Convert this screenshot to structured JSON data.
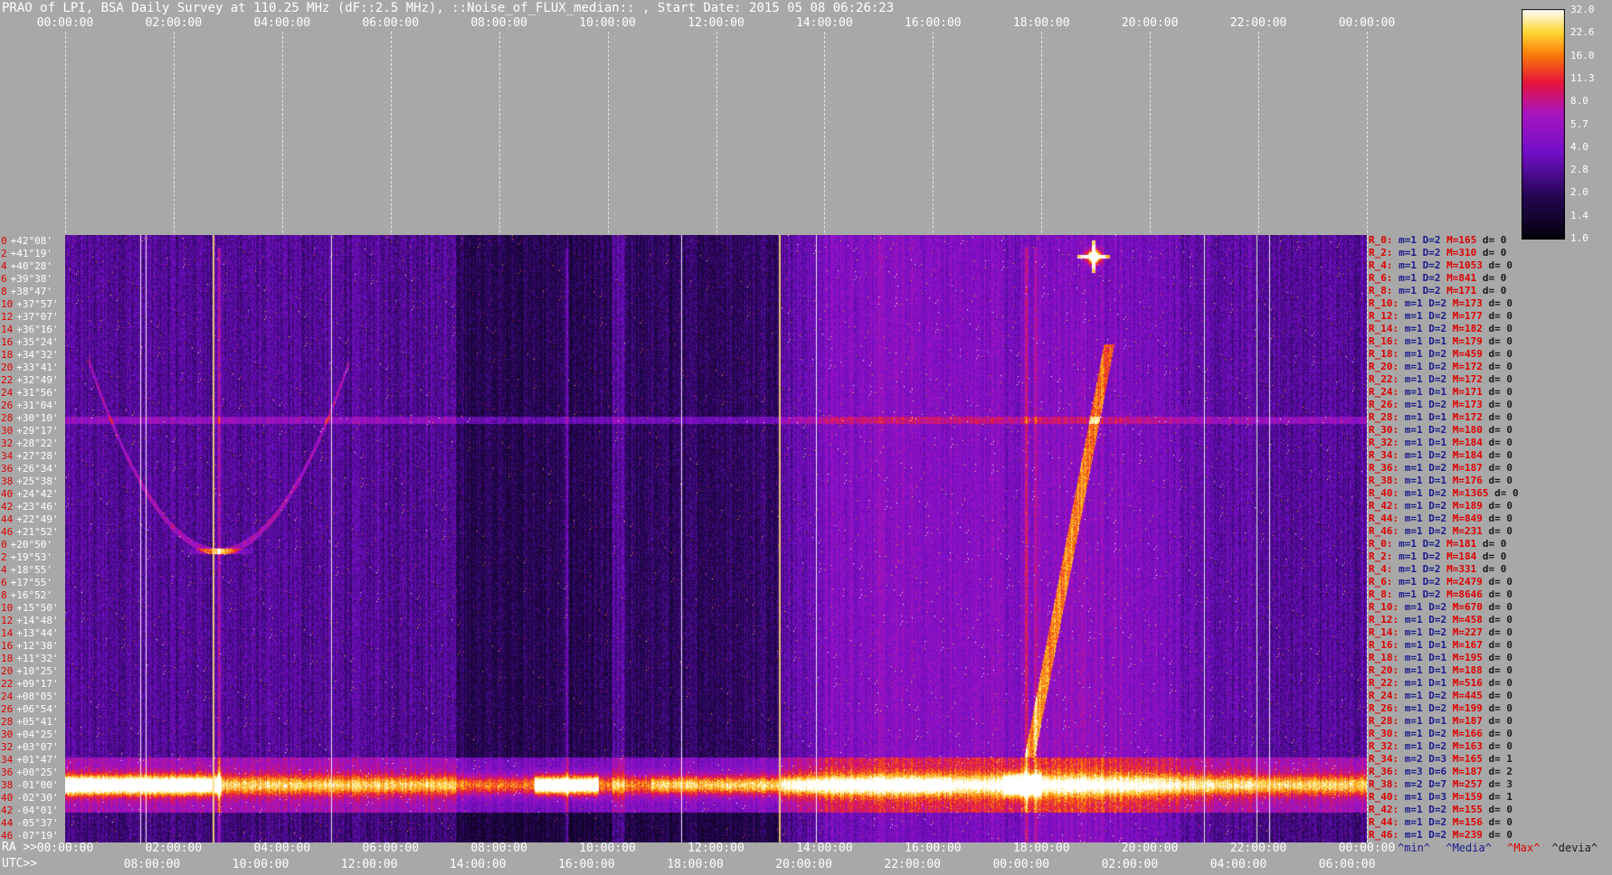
{
  "title": "PRAO of LPI, BSA Daily Survey at 110.25 MHz (dF::2.5 MHz), ::Noise_of_FLUX_median:: , Start Date: 2015 05 08 06:26:23",
  "top_ticks": [
    "00:00:00",
    "02:00:00",
    "04:00:00",
    "06:00:00",
    "08:00:00",
    "10:00:00",
    "12:00:00",
    "14:00:00",
    "16:00:00",
    "18:00:00",
    "20:00:00",
    "22:00:00",
    "00:00:00"
  ],
  "ra_label": "RA >>",
  "utc_label": "UTC>>",
  "ra_ticks": [
    "00:00:00",
    "02:00:00",
    "04:00:00",
    "06:00:00",
    "08:00:00",
    "10:00:00",
    "12:00:00",
    "14:00:00",
    "16:00:00",
    "18:00:00",
    "20:00:00",
    "22:00:00",
    "00:00:00"
  ],
  "utc_ticks": [
    "08:00:00",
    "10:00:00",
    "12:00:00",
    "14:00:00",
    "16:00:00",
    "18:00:00",
    "20:00:00",
    "22:00:00",
    "00:00:00",
    "02:00:00",
    "04:00:00",
    "06:00:00"
  ],
  "declinations": [
    {
      "n": "0",
      "v": "+42°08'"
    },
    {
      "n": "2",
      "v": "+41°19'"
    },
    {
      "n": "4",
      "v": "+40°28'"
    },
    {
      "n": "6",
      "v": "+39°38'"
    },
    {
      "n": "8",
      "v": "+38°47'"
    },
    {
      "n": "10",
      "v": "+37°57'"
    },
    {
      "n": "12",
      "v": "+37°07'"
    },
    {
      "n": "14",
      "v": "+36°16'"
    },
    {
      "n": "16",
      "v": "+35°24'"
    },
    {
      "n": "18",
      "v": "+34°32'"
    },
    {
      "n": "20",
      "v": "+33°41'"
    },
    {
      "n": "22",
      "v": "+32°49'"
    },
    {
      "n": "24",
      "v": "+31°56'"
    },
    {
      "n": "26",
      "v": "+31°04'"
    },
    {
      "n": "28",
      "v": "+30°10'"
    },
    {
      "n": "30",
      "v": "+29°17'"
    },
    {
      "n": "32",
      "v": "+28°22'"
    },
    {
      "n": "34",
      "v": "+27°28'"
    },
    {
      "n": "36",
      "v": "+26°34'"
    },
    {
      "n": "38",
      "v": "+25°38'"
    },
    {
      "n": "40",
      "v": "+24°42'"
    },
    {
      "n": "42",
      "v": "+23°46'"
    },
    {
      "n": "44",
      "v": "+22°49'"
    },
    {
      "n": "46",
      "v": "+21°52'"
    },
    {
      "n": "0",
      "v": "+20°50'"
    },
    {
      "n": "2",
      "v": "+19°53'"
    },
    {
      "n": "4",
      "v": "+18°55'"
    },
    {
      "n": "6",
      "v": "+17°55'"
    },
    {
      "n": "8",
      "v": "+16°52'"
    },
    {
      "n": "10",
      "v": "+15°50'"
    },
    {
      "n": "12",
      "v": "+14°48'"
    },
    {
      "n": "14",
      "v": "+13°44'"
    },
    {
      "n": "16",
      "v": "+12°38'"
    },
    {
      "n": "18",
      "v": "+11°32'"
    },
    {
      "n": "20",
      "v": "+10°25'"
    },
    {
      "n": "22",
      "v": "+09°17'"
    },
    {
      "n": "24",
      "v": "+08°05'"
    },
    {
      "n": "26",
      "v": "+06°54'"
    },
    {
      "n": "28",
      "v": "+05°41'"
    },
    {
      "n": "30",
      "v": "+04°25'"
    },
    {
      "n": "32",
      "v": "+03°07'"
    },
    {
      "n": "34",
      "v": "+01°47'"
    },
    {
      "n": "36",
      "v": "+00°25'"
    },
    {
      "n": "38",
      "v": "-01°00'"
    },
    {
      "n": "40",
      "v": "-02°30'"
    },
    {
      "n": "42",
      "v": "-04°01'"
    },
    {
      "n": "44",
      "v": "-05°37'"
    },
    {
      "n": "46",
      "v": "-07°19'"
    }
  ],
  "stats": [
    {
      "r": "R_0:",
      "m": "m=1",
      "d": "D=2",
      "x": "M=165",
      "dv": "d= 0"
    },
    {
      "r": "R_2:",
      "m": "m=1",
      "d": "D=2",
      "x": "M=310",
      "dv": "d= 0"
    },
    {
      "r": "R_4:",
      "m": "m=1",
      "d": "D=2",
      "x": "M=1053",
      "dv": "d= 0"
    },
    {
      "r": "R_6:",
      "m": "m=1",
      "d": "D=2",
      "x": "M=841",
      "dv": "d= 0"
    },
    {
      "r": "R_8:",
      "m": "m=1",
      "d": "D=2",
      "x": "M=171",
      "dv": "d= 0"
    },
    {
      "r": "R_10:",
      "m": "m=1",
      "d": "D=2",
      "x": "M=173",
      "dv": "d= 0"
    },
    {
      "r": "R_12:",
      "m": "m=1",
      "d": "D=2",
      "x": "M=177",
      "dv": "d= 0"
    },
    {
      "r": "R_14:",
      "m": "m=1",
      "d": "D=2",
      "x": "M=182",
      "dv": "d= 0"
    },
    {
      "r": "R_16:",
      "m": "m=1",
      "d": "D=1",
      "x": "M=179",
      "dv": "d= 0"
    },
    {
      "r": "R_18:",
      "m": "m=1",
      "d": "D=2",
      "x": "M=459",
      "dv": "d= 0"
    },
    {
      "r": "R_20:",
      "m": "m=1",
      "d": "D=2",
      "x": "M=172",
      "dv": "d= 0"
    },
    {
      "r": "R_22:",
      "m": "m=1",
      "d": "D=2",
      "x": "M=172",
      "dv": "d= 0"
    },
    {
      "r": "R_24:",
      "m": "m=1",
      "d": "D=1",
      "x": "M=171",
      "dv": "d= 0"
    },
    {
      "r": "R_26:",
      "m": "m=1",
      "d": "D=2",
      "x": "M=173",
      "dv": "d= 0"
    },
    {
      "r": "R_28:",
      "m": "m=1",
      "d": "D=1",
      "x": "M=172",
      "dv": "d= 0"
    },
    {
      "r": "R_30:",
      "m": "m=1",
      "d": "D=2",
      "x": "M=180",
      "dv": "d= 0"
    },
    {
      "r": "R_32:",
      "m": "m=1",
      "d": "D=1",
      "x": "M=184",
      "dv": "d= 0"
    },
    {
      "r": "R_34:",
      "m": "m=1",
      "d": "D=2",
      "x": "M=184",
      "dv": "d= 0"
    },
    {
      "r": "R_36:",
      "m": "m=1",
      "d": "D=2",
      "x": "M=187",
      "dv": "d= 0"
    },
    {
      "r": "R_38:",
      "m": "m=1",
      "d": "D=1",
      "x": "M=176",
      "dv": "d= 0"
    },
    {
      "r": "R_40:",
      "m": "m=1",
      "d": "D=2",
      "x": "M=1365",
      "dv": "d= 0"
    },
    {
      "r": "R_42:",
      "m": "m=1",
      "d": "D=2",
      "x": "M=189",
      "dv": "d= 0"
    },
    {
      "r": "R_44:",
      "m": "m=1",
      "d": "D=2",
      "x": "M=849",
      "dv": "d= 0"
    },
    {
      "r": "R_46:",
      "m": "m=1",
      "d": "D=2",
      "x": "M=231",
      "dv": "d= 0"
    },
    {
      "r": "R_0:",
      "m": "m=1",
      "d": "D=2",
      "x": "M=181",
      "dv": "d= 0"
    },
    {
      "r": "R_2:",
      "m": "m=1",
      "d": "D=2",
      "x": "M=184",
      "dv": "d= 0"
    },
    {
      "r": "R_4:",
      "m": "m=1",
      "d": "D=2",
      "x": "M=331",
      "dv": "d= 0"
    },
    {
      "r": "R_6:",
      "m": "m=1",
      "d": "D=2",
      "x": "M=2479",
      "dv": "d= 0"
    },
    {
      "r": "R_8:",
      "m": "m=1",
      "d": "D=2",
      "x": "M=8646",
      "dv": "d= 0"
    },
    {
      "r": "R_10:",
      "m": "m=1",
      "d": "D=2",
      "x": "M=670",
      "dv": "d= 0"
    },
    {
      "r": "R_12:",
      "m": "m=1",
      "d": "D=2",
      "x": "M=458",
      "dv": "d= 0"
    },
    {
      "r": "R_14:",
      "m": "m=1",
      "d": "D=2",
      "x": "M=227",
      "dv": "d= 0"
    },
    {
      "r": "R_16:",
      "m": "m=1",
      "d": "D=1",
      "x": "M=167",
      "dv": "d= 0"
    },
    {
      "r": "R_18:",
      "m": "m=1",
      "d": "D=1",
      "x": "M=195",
      "dv": "d= 0"
    },
    {
      "r": "R_20:",
      "m": "m=1",
      "d": "D=1",
      "x": "M=188",
      "dv": "d= 0"
    },
    {
      "r": "R_22:",
      "m": "m=1",
      "d": "D=1",
      "x": "M=516",
      "dv": "d= 0"
    },
    {
      "r": "R_24:",
      "m": "m=1",
      "d": "D=2",
      "x": "M=445",
      "dv": "d= 0"
    },
    {
      "r": "R_26:",
      "m": "m=1",
      "d": "D=2",
      "x": "M=199",
      "dv": "d= 0"
    },
    {
      "r": "R_28:",
      "m": "m=1",
      "d": "D=1",
      "x": "M=187",
      "dv": "d= 0"
    },
    {
      "r": "R_30:",
      "m": "m=1",
      "d": "D=2",
      "x": "M=166",
      "dv": "d= 0"
    },
    {
      "r": "R_32:",
      "m": "m=1",
      "d": "D=2",
      "x": "M=163",
      "dv": "d= 0"
    },
    {
      "r": "R_34:",
      "m": "m=2",
      "d": "D=3",
      "x": "M=165",
      "dv": "d= 1"
    },
    {
      "r": "R_36:",
      "m": "m=3",
      "d": "D=6",
      "x": "M=187",
      "dv": "d= 2"
    },
    {
      "r": "R_38:",
      "m": "m=2",
      "d": "D=7",
      "x": "M=257",
      "dv": "d= 3"
    },
    {
      "r": "R_40:",
      "m": "m=1",
      "d": "D=3",
      "x": "M=159",
      "dv": "d= 1"
    },
    {
      "r": "R_42:",
      "m": "m=1",
      "d": "D=2",
      "x": "M=155",
      "dv": "d= 0"
    },
    {
      "r": "R_44:",
      "m": "m=1",
      "d": "D=2",
      "x": "M=156",
      "dv": "d= 0"
    },
    {
      "r": "R_46:",
      "m": "m=1",
      "d": "D=2",
      "x": "M=239",
      "dv": "d= 0"
    }
  ],
  "legend": {
    "min": "^min^",
    "median": "^Media^",
    "max": "^Max^",
    "dev": "^devia^"
  },
  "colorbar_ticks": [
    "32.0",
    "22.6",
    "16.0",
    "11.3",
    "8.0",
    "5.7",
    "4.0",
    "2.8",
    "2.0",
    "1.4",
    "1.0"
  ],
  "colors": {
    "background": "#a8a8a8",
    "plot_low": "#05020f",
    "plot_mid": "#7a12c8",
    "plot_high": "#ffd23a",
    "peak": "#ffffff",
    "label_red": "#dd0000",
    "label_blue": "#1a1a8c"
  },
  "chart_data": {
    "type": "heatmap",
    "title": "PRAO of LPI, BSA Daily Survey at 110.25 MHz (dF::2.5 MHz), ::Noise_of_FLUX_median:: , Start Date: 2015 05 08 06:26:23",
    "xlabel": "RA",
    "ylabel": "",
    "x_ticks_ra": [
      "00:00:00",
      "02:00:00",
      "04:00:00",
      "06:00:00",
      "08:00:00",
      "10:00:00",
      "12:00:00",
      "14:00:00",
      "16:00:00",
      "18:00:00",
      "20:00:00",
      "22:00:00",
      "00:00:00"
    ],
    "x_ticks_utc": [
      "08:00:00",
      "10:00:00",
      "12:00:00",
      "14:00:00",
      "16:00:00",
      "18:00:00",
      "20:00:00",
      "22:00:00",
      "00:00:00",
      "02:00:00",
      "04:00:00",
      "06:00:00"
    ],
    "colorbar": {
      "min": 1.0,
      "max": 32.0,
      "scale": "log",
      "ticks": [
        32.0,
        22.6,
        16.0,
        11.3,
        8.0,
        5.7,
        4.0,
        2.8,
        2.0,
        1.4,
        1.0
      ]
    },
    "rows": 48
  }
}
